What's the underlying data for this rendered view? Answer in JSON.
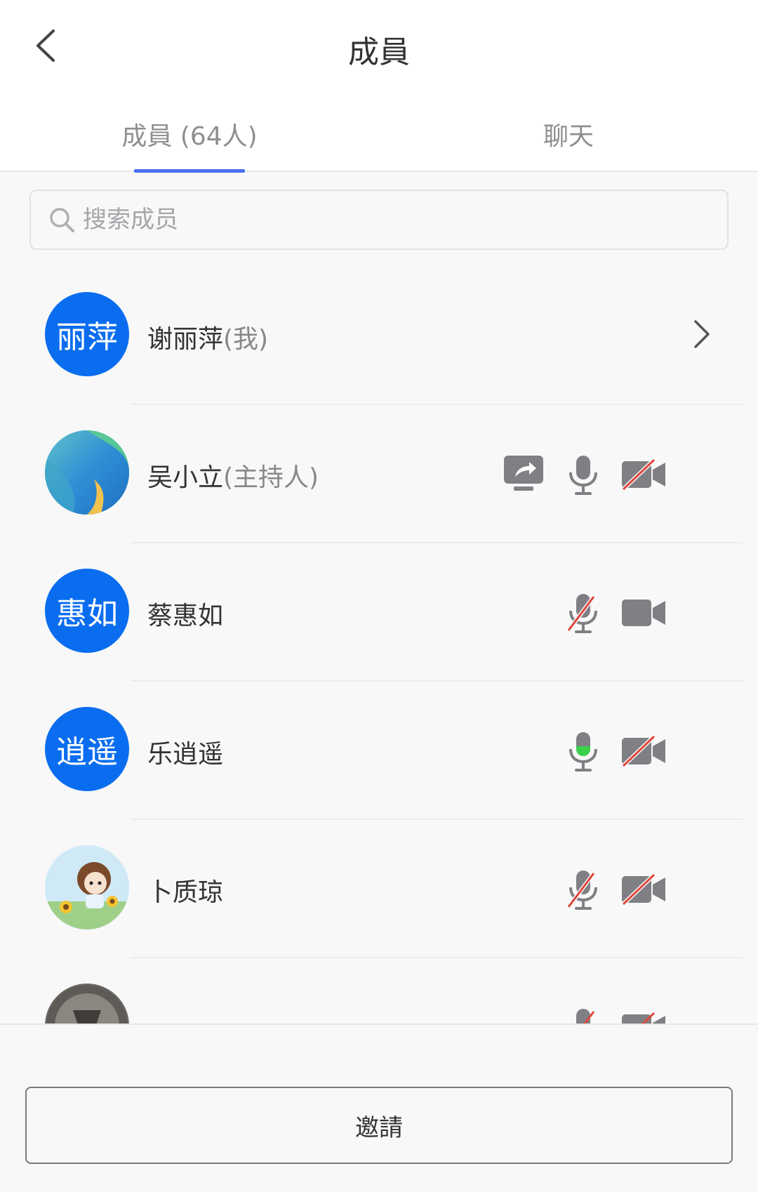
{
  "header": {
    "title": "成員",
    "tabs": [
      {
        "label": "成員 (64人)",
        "active": true
      },
      {
        "label": "聊天",
        "active": false
      }
    ]
  },
  "search": {
    "placeholder": "搜索成员"
  },
  "members": [
    {
      "avatar_text": "丽萍",
      "name": "谢丽萍",
      "role": "(我)",
      "icons": [
        "chevron-right"
      ]
    },
    {
      "avatar_text": "",
      "avatar_image": "blue-green-abstract",
      "name": "吴小立",
      "role": "(主持人)",
      "icons": [
        "screen-share",
        "mic-on",
        "camera-off"
      ]
    },
    {
      "avatar_text": "惠如",
      "name": "蔡惠如",
      "role": "",
      "icons": [
        "mic-off",
        "camera-on"
      ]
    },
    {
      "avatar_text": "逍遥",
      "name": "乐逍遥",
      "role": "",
      "icons": [
        "mic-speaking",
        "camera-off"
      ]
    },
    {
      "avatar_text": "",
      "avatar_image": "cartoon-girl-sunflowers",
      "name": "卜质琼",
      "role": "",
      "icons": [
        "mic-off",
        "camera-off"
      ]
    }
  ],
  "footer": {
    "invite_label": "邀請"
  },
  "colors": {
    "accent": "#4a6ff0",
    "avatar_blue": "#0a6df0",
    "mute_red": "#e0463c",
    "speaking_green": "#3ad14a"
  }
}
